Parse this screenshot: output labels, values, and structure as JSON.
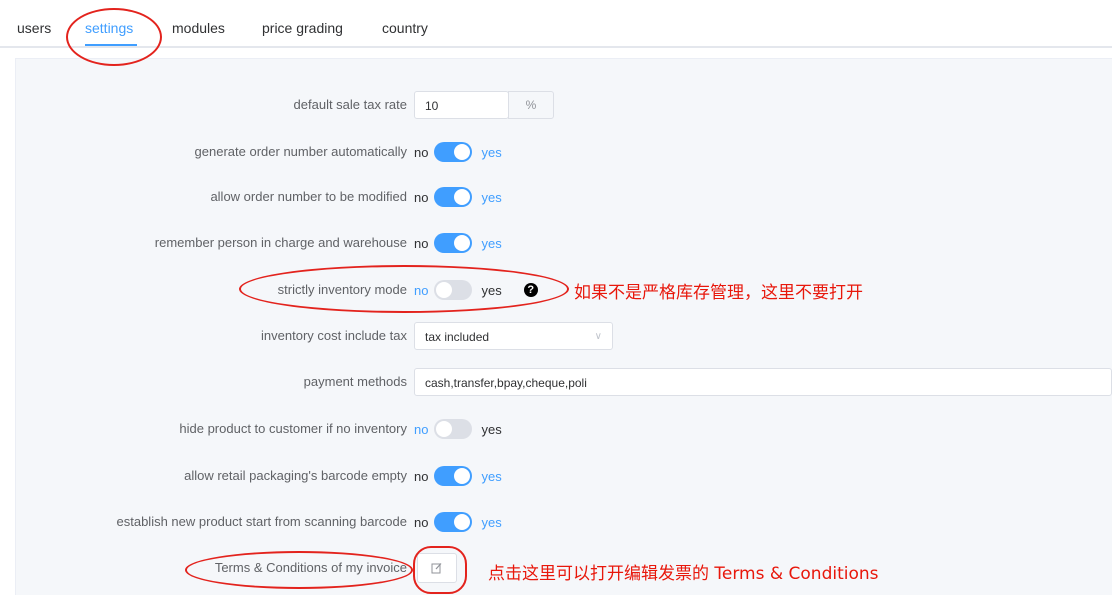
{
  "tabs": [
    {
      "label": "users",
      "active": false
    },
    {
      "label": "settings",
      "active": true
    },
    {
      "label": "modules",
      "active": false
    },
    {
      "label": "price grading",
      "active": false
    },
    {
      "label": "country",
      "active": false
    }
  ],
  "settings": {
    "tax_rate": {
      "label": "default sale tax rate",
      "value": "10",
      "unit": "%"
    },
    "auto_order_number": {
      "label": "generate order number automatically",
      "off": "no",
      "on": "yes",
      "enabled": true
    },
    "modify_order_number": {
      "label": "allow order number to be modified",
      "off": "no",
      "on": "yes",
      "enabled": true
    },
    "remember_person": {
      "label": "remember person in charge and warehouse",
      "off": "no",
      "on": "yes",
      "enabled": true
    },
    "strict_inventory": {
      "label": "strictly inventory mode",
      "off": "no",
      "on": "yes",
      "enabled": false,
      "help": "?"
    },
    "cost_tax": {
      "label": "inventory cost include tax",
      "value": "tax included"
    },
    "payment_methods": {
      "label": "payment methods",
      "value": "cash,transfer,bpay,cheque,poli"
    },
    "hide_product": {
      "label": "hide product to customer if no inventory",
      "off": "no",
      "on": "yes",
      "enabled": false
    },
    "barcode_empty": {
      "label": "allow retail packaging's barcode empty",
      "off": "no",
      "on": "yes",
      "enabled": true
    },
    "scan_barcode": {
      "label": "establish new product start from scanning barcode",
      "off": "no",
      "on": "yes",
      "enabled": true
    },
    "terms": {
      "label": "Terms & Conditions of my invoice"
    }
  },
  "annotations": {
    "strict_note": "如果不是严格库存管理，这里不要打开",
    "terms_note": "点击这里可以打开编辑发票的 Terms & Conditions"
  },
  "colors": {
    "accent": "#409eff",
    "annotation": "#e3231d"
  },
  "icons": {
    "help": "question-circle-icon",
    "edit": "edit-icon",
    "chevron": "chevron-down-icon"
  }
}
